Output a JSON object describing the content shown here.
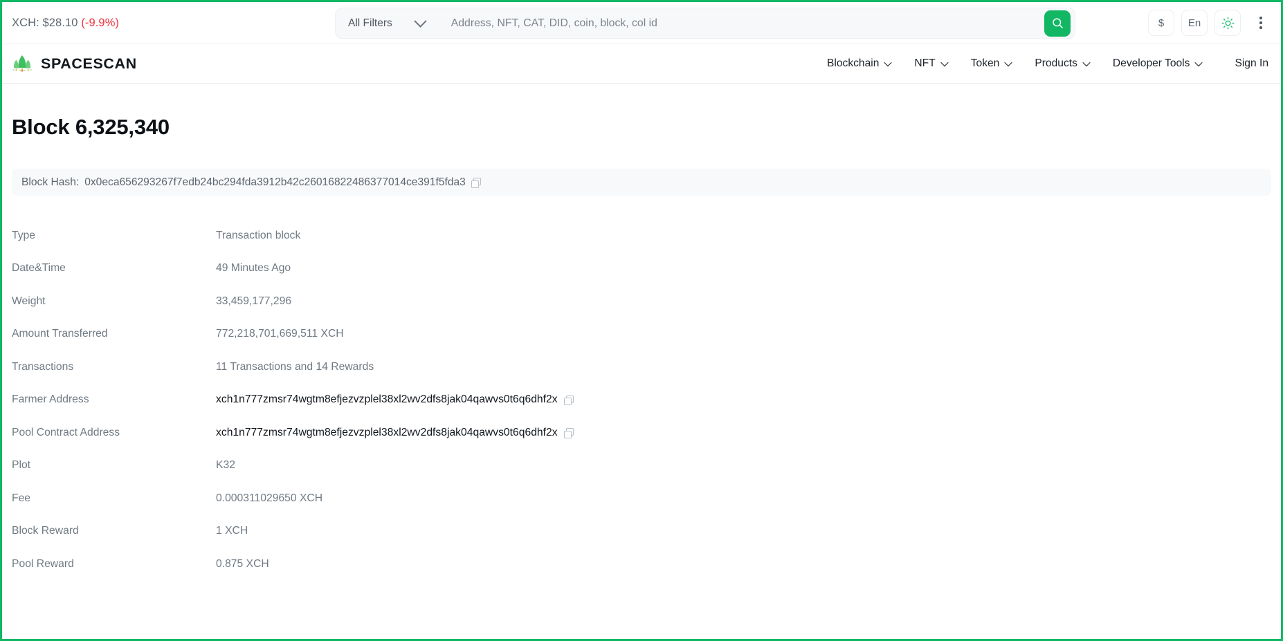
{
  "topbar": {
    "ticker_label": "XCH: $28.10",
    "ticker_change": "(-9.9%)",
    "filter_label": "All Filters",
    "search_placeholder": "Address, NFT, CAT, DID, coin, block, col id",
    "search_value": "",
    "search_icon": "search-icon",
    "currency_label": "$",
    "language_label": "En",
    "theme_icon": "sun-icon",
    "overflow_icon": "vertical-dots-icon"
  },
  "nav": {
    "logo_icon": "spacescan-rocket-logo",
    "brand": "SPACESCAN",
    "links": [
      {
        "label": "Blockchain",
        "has_chevron": true
      },
      {
        "label": "NFT",
        "has_chevron": true
      },
      {
        "label": "Token",
        "has_chevron": true
      },
      {
        "label": "Products",
        "has_chevron": true
      },
      {
        "label": "Developer Tools",
        "has_chevron": true
      }
    ],
    "sign_in": "Sign In"
  },
  "page": {
    "title": "Block 6,325,340",
    "hash_label": "Block Hash:",
    "hash_value": "0x0eca656293267f7edb24bc294fda3912b42c26016822486377014ce391f5fda3"
  },
  "details": [
    {
      "label": "Type",
      "value": "Transaction block",
      "copy": false,
      "mono": false
    },
    {
      "label": "Date&Time",
      "value": "49 Minutes Ago",
      "copy": false,
      "mono": false
    },
    {
      "label": "Weight",
      "value": "33,459,177,296",
      "copy": false,
      "mono": false
    },
    {
      "label": "Amount Transferred",
      "value": "772,218,701,669,511 XCH",
      "copy": false,
      "mono": false
    },
    {
      "label": "Transactions",
      "value": "11 Transactions and 14 Rewards",
      "copy": false,
      "mono": false
    },
    {
      "label": "Farmer Address",
      "value": "xch1n777zmsr74wgtm8efjezvzplel38xl2wv2dfs8jak04qawvs0t6q6dhf2x",
      "copy": true,
      "mono": true
    },
    {
      "label": "Pool Contract Address",
      "value": "xch1n777zmsr74wgtm8efjezvzplel38xl2wv2dfs8jak04qawvs0t6q6dhf2x",
      "copy": true,
      "mono": true
    },
    {
      "label": "Plot",
      "value": "K32",
      "copy": false,
      "mono": false
    },
    {
      "label": "Fee",
      "value": "0.000311029650 XCH",
      "copy": false,
      "mono": false
    },
    {
      "label": "Block Reward",
      "value": "1 XCH",
      "copy": false,
      "mono": false
    },
    {
      "label": "Pool Reward",
      "value": "0.875 XCH",
      "copy": false,
      "mono": false
    }
  ],
  "colors": {
    "accent_green": "#12b764",
    "negative_red": "#f0323c",
    "text_muted": "#707A84",
    "text_dark": "#11161b"
  }
}
